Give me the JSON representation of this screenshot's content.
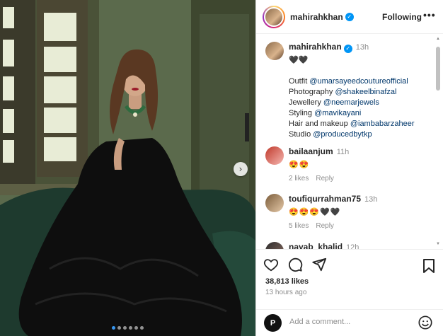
{
  "post": {
    "author": "mahirahkhan",
    "follow_label": "Following",
    "more_label": "•••",
    "carousel": {
      "dot_count": 6,
      "active_index": 0,
      "next_glyph": "›"
    }
  },
  "caption": {
    "author": "mahirahkhan",
    "time": "13h",
    "emoji": "🖤🖤",
    "lines": [
      {
        "label": "Outfit ",
        "mention": "@umarsayeedcoutureofficial"
      },
      {
        "label": "Photography ",
        "mention": "@shakeelbinafzal"
      },
      {
        "label": "Jewellery ",
        "mention": "@neemarjewels"
      },
      {
        "label": "Styling ",
        "mention": "@mavikayani"
      },
      {
        "label": "Hair and makeup ",
        "mention": "@iambabarzaheer"
      },
      {
        "label": "Studio ",
        "mention": "@producedbytkp"
      }
    ]
  },
  "comments": [
    {
      "user": "bailaanjum",
      "time": "11h",
      "text": "😍😍",
      "likes": "2 likes",
      "reply": "Reply"
    },
    {
      "user": "toufiqurrahman75",
      "time": "13h",
      "text": "😍😍😍🖤🖤",
      "likes": "5 likes",
      "reply": "Reply"
    },
    {
      "user": "nayab_khalid",
      "time": "12h"
    }
  ],
  "stats": {
    "likes": "38,813 likes",
    "time_ago": "13 hours ago"
  },
  "add_comment": {
    "placeholder": "Add a comment...",
    "avatar_letter": "P"
  },
  "icons": {
    "like": "heart-icon",
    "comment": "comment-icon",
    "share": "share-icon",
    "save": "bookmark-icon",
    "emoji": "emoji-icon",
    "verified": "verified-badge-icon"
  },
  "colors": {
    "link": "#00376b",
    "verified": "#0095f6",
    "muted": "#8e8e8e",
    "active_dot": "#3897f0"
  }
}
